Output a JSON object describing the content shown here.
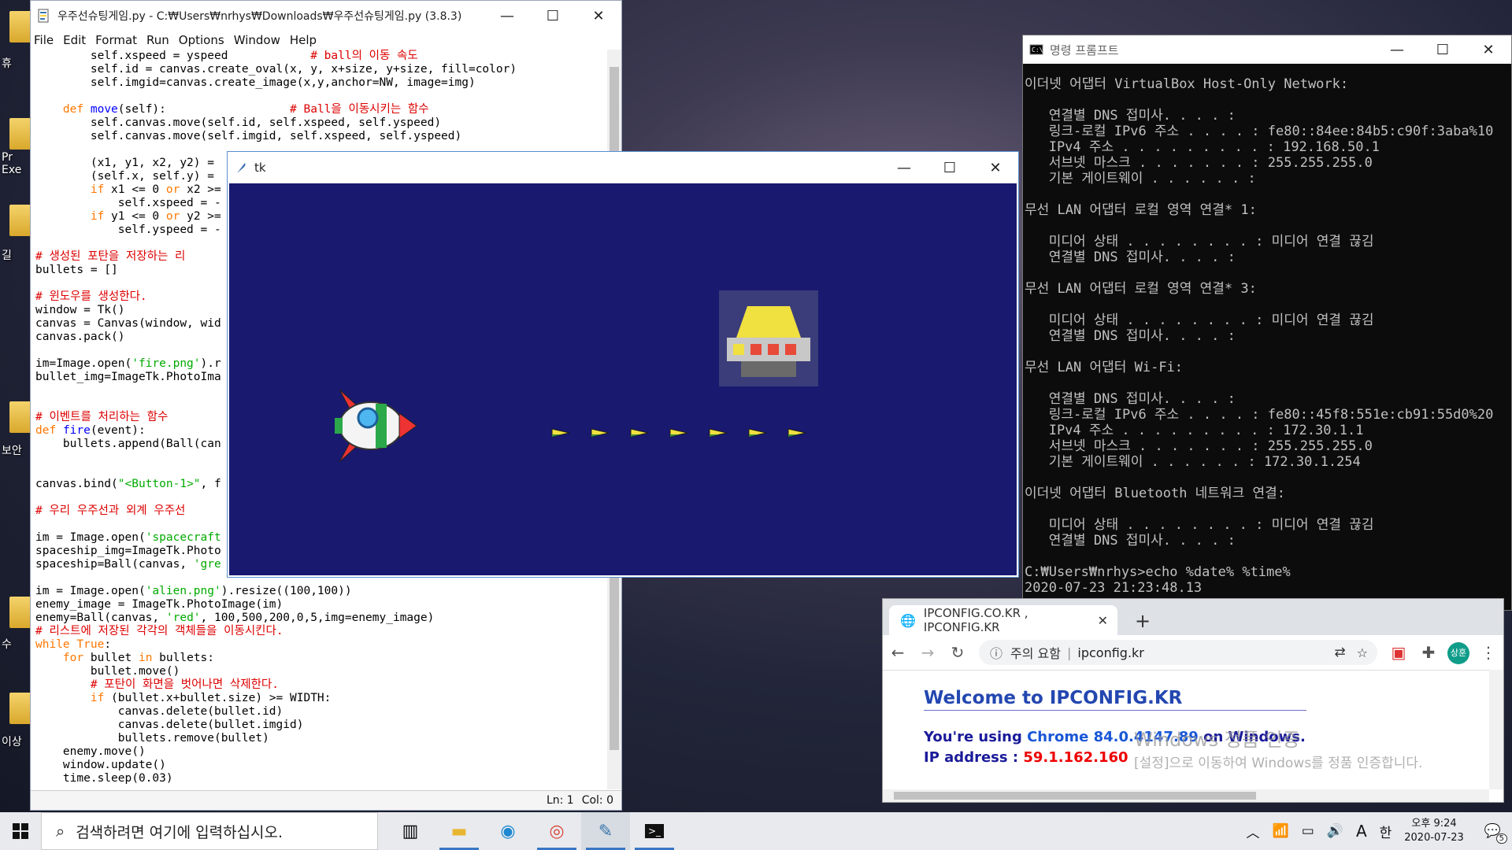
{
  "desktop": {
    "icon_labels": [
      "휴",
      "Pr Exe",
      "길",
      "보안",
      "수",
      "이상"
    ]
  },
  "idle": {
    "title": "우주선슈팅게임.py - C:₩Users₩nrhys₩Downloads₩우주선슈팅게임.py (3.8.3)",
    "menu": [
      "File",
      "Edit",
      "Format",
      "Run",
      "Options",
      "Window",
      "Help"
    ],
    "status_ln": "Ln: 1",
    "status_col": "Col: 0"
  },
  "tk": {
    "title": "tk"
  },
  "cmd": {
    "title": "명령 프롬프트"
  },
  "chrome": {
    "tab_title": "IPCONFIG.CO.KR , IPCONFIG.KR",
    "security_label": "주의 요함",
    "url": "ipconfig.kr",
    "profile": "상훈",
    "welcome": "Welcome to IPCONFIG.KR",
    "using_prefix": "You're using ",
    "browser_name": "Chrome 84.0.4147.89",
    "using_suffix": " on Windows.",
    "ip_label": "IP address : ",
    "ip_value": "59.1.162.160"
  },
  "activation": {
    "line1": "Windows 정품 인증",
    "line2": "[설정]으로 이동하여 Windows를 정품 인증합니다."
  },
  "taskbar": {
    "search_placeholder": "검색하려면 여기에 입력하십시오.",
    "ime_label": "한",
    "clock_time": "오후 9:24",
    "clock_date": "2020-07-23",
    "notification_count": "5",
    "input_mode": "A"
  },
  "colors": {
    "canvas_bg": "#191970",
    "cmd_bg": "#0c0c0c"
  }
}
